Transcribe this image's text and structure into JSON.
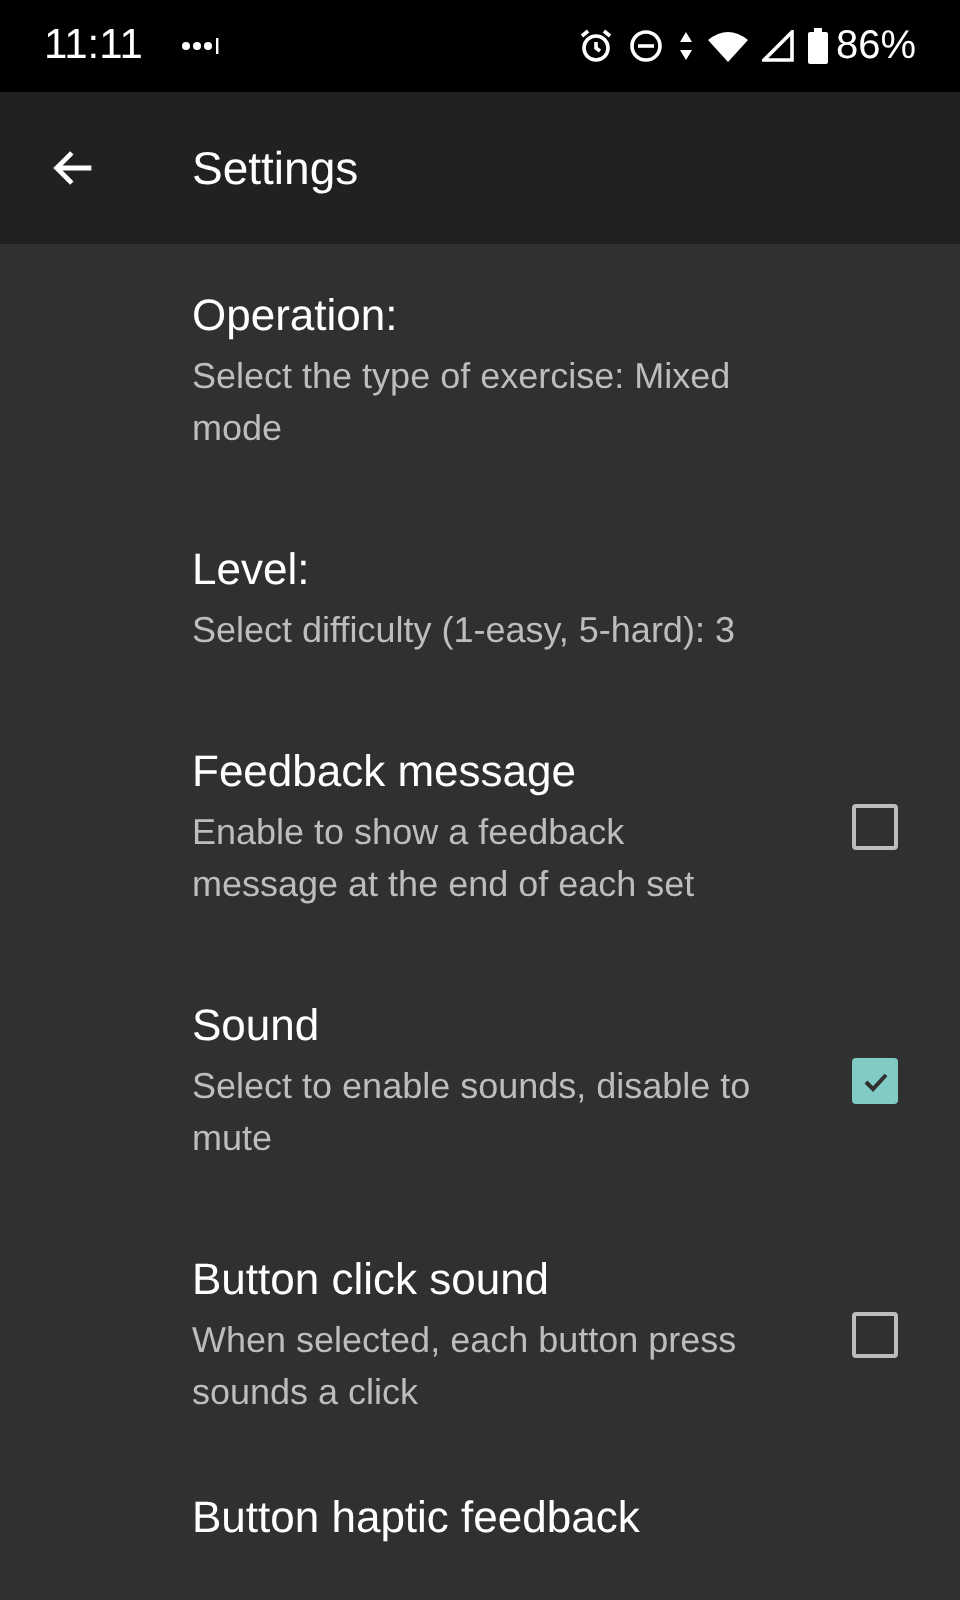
{
  "status_bar": {
    "time": "11:11",
    "battery": "86%"
  },
  "app_bar": {
    "title": "Settings"
  },
  "settings": [
    {
      "kind": "text",
      "title": "Operation:",
      "summary": "Select the type of exercise: Mixed mode"
    },
    {
      "kind": "text",
      "title": "Level:",
      "summary": "Select difficulty (1-easy, 5-hard): 3"
    },
    {
      "kind": "checkbox",
      "title": "Feedback message",
      "summary": "Enable to show a feedback message at the end of each set",
      "checked": false
    },
    {
      "kind": "checkbox",
      "title": "Sound",
      "summary": "Select to enable sounds, disable to mute",
      "checked": true
    },
    {
      "kind": "checkbox",
      "title": "Button click sound",
      "summary": "When selected, each button press sounds a click",
      "checked": false
    },
    {
      "kind": "heading",
      "title": "Button haptic feedback"
    }
  ]
}
